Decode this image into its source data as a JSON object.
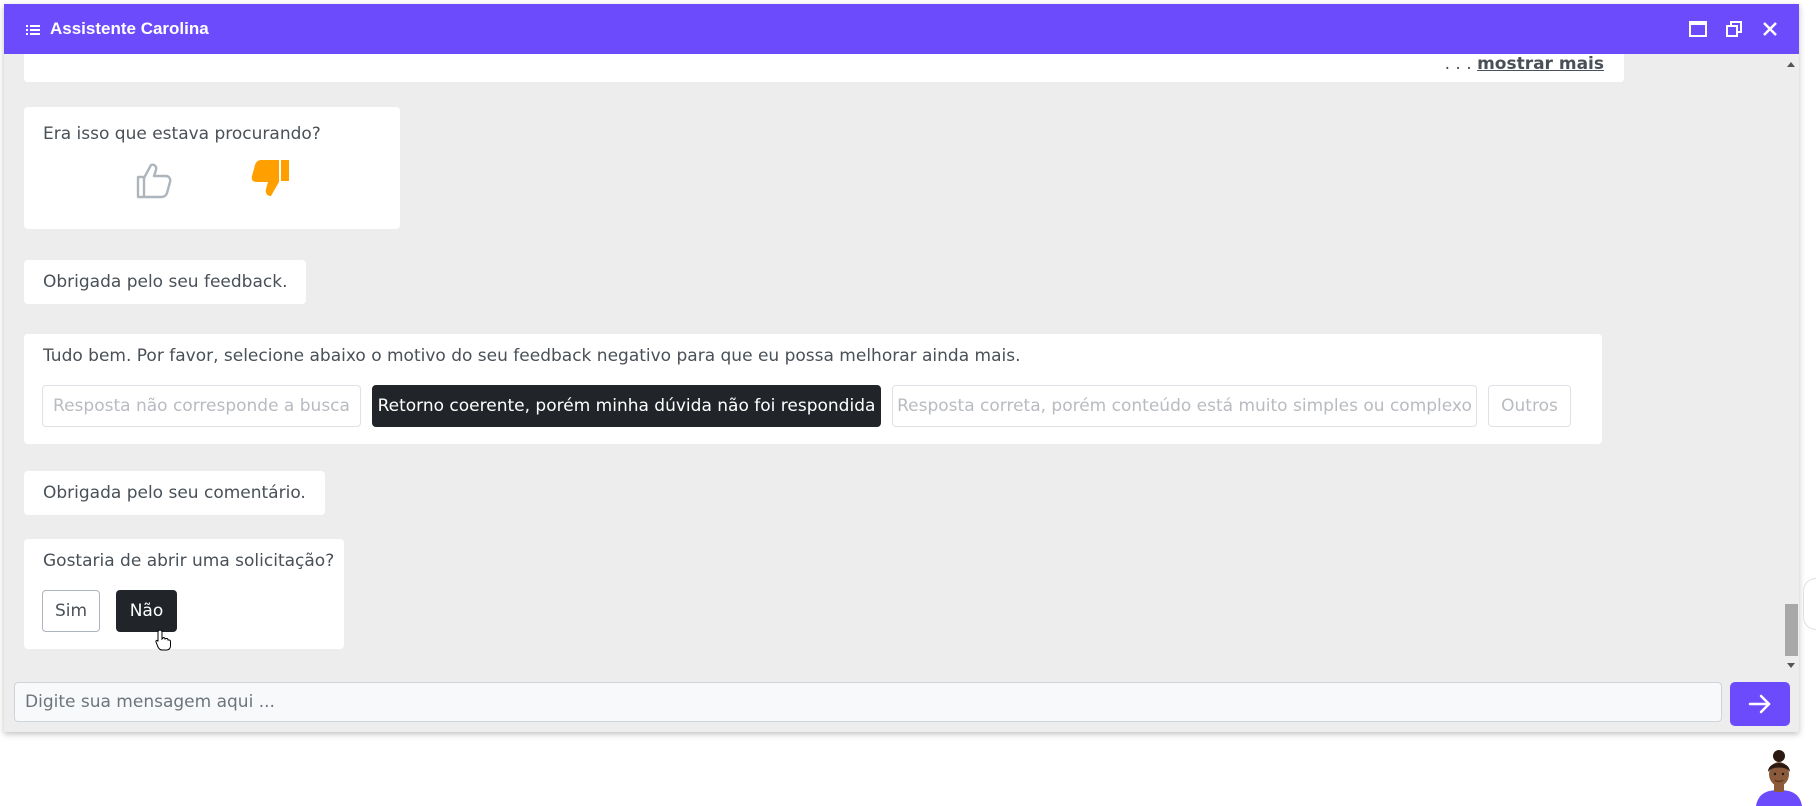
{
  "window": {
    "title": "Assistente Carolina",
    "accent_color": "#6c4bfd",
    "icons": {
      "menu": "list-icon",
      "maximize": "maximize-icon",
      "restore": "restore-icon",
      "close": "close-icon"
    }
  },
  "messages": {
    "truncated": {
      "ellipsis": ". . .",
      "show_more": "mostrar mais"
    },
    "feedback_question": {
      "text": "Era isso que estava procurando?",
      "thumbs_up": "thumbs-up-icon",
      "thumbs_down": "thumbs-down-icon",
      "thumbs_down_color": "#ffa000"
    },
    "thanks_feedback": "Obrigada pelo seu feedback.",
    "reason_prompt": {
      "text": "Tudo bem. Por favor, selecione abaixo o motivo do seu feedback negativo para que eu possa melhorar ainda mais.",
      "options": [
        "Resposta não corresponde a busca",
        "Retorno coerente, porém minha dúvida não foi respondida",
        "Resposta correta, porém conteúdo está muito simples ou complexo",
        "Outros"
      ],
      "selected": "Retorno coerente, porém minha dúvida não foi respondida"
    },
    "thanks_comment": "Obrigada pelo seu comentário.",
    "request_prompt": {
      "text": "Gostaria de abrir uma solicitação?",
      "yes": "Sim",
      "no": "Não",
      "selected": "Não"
    }
  },
  "composer": {
    "placeholder": "Digite sua mensagem aqui ...",
    "send_icon": "arrow-right-icon"
  },
  "avatar": "assistant-avatar"
}
